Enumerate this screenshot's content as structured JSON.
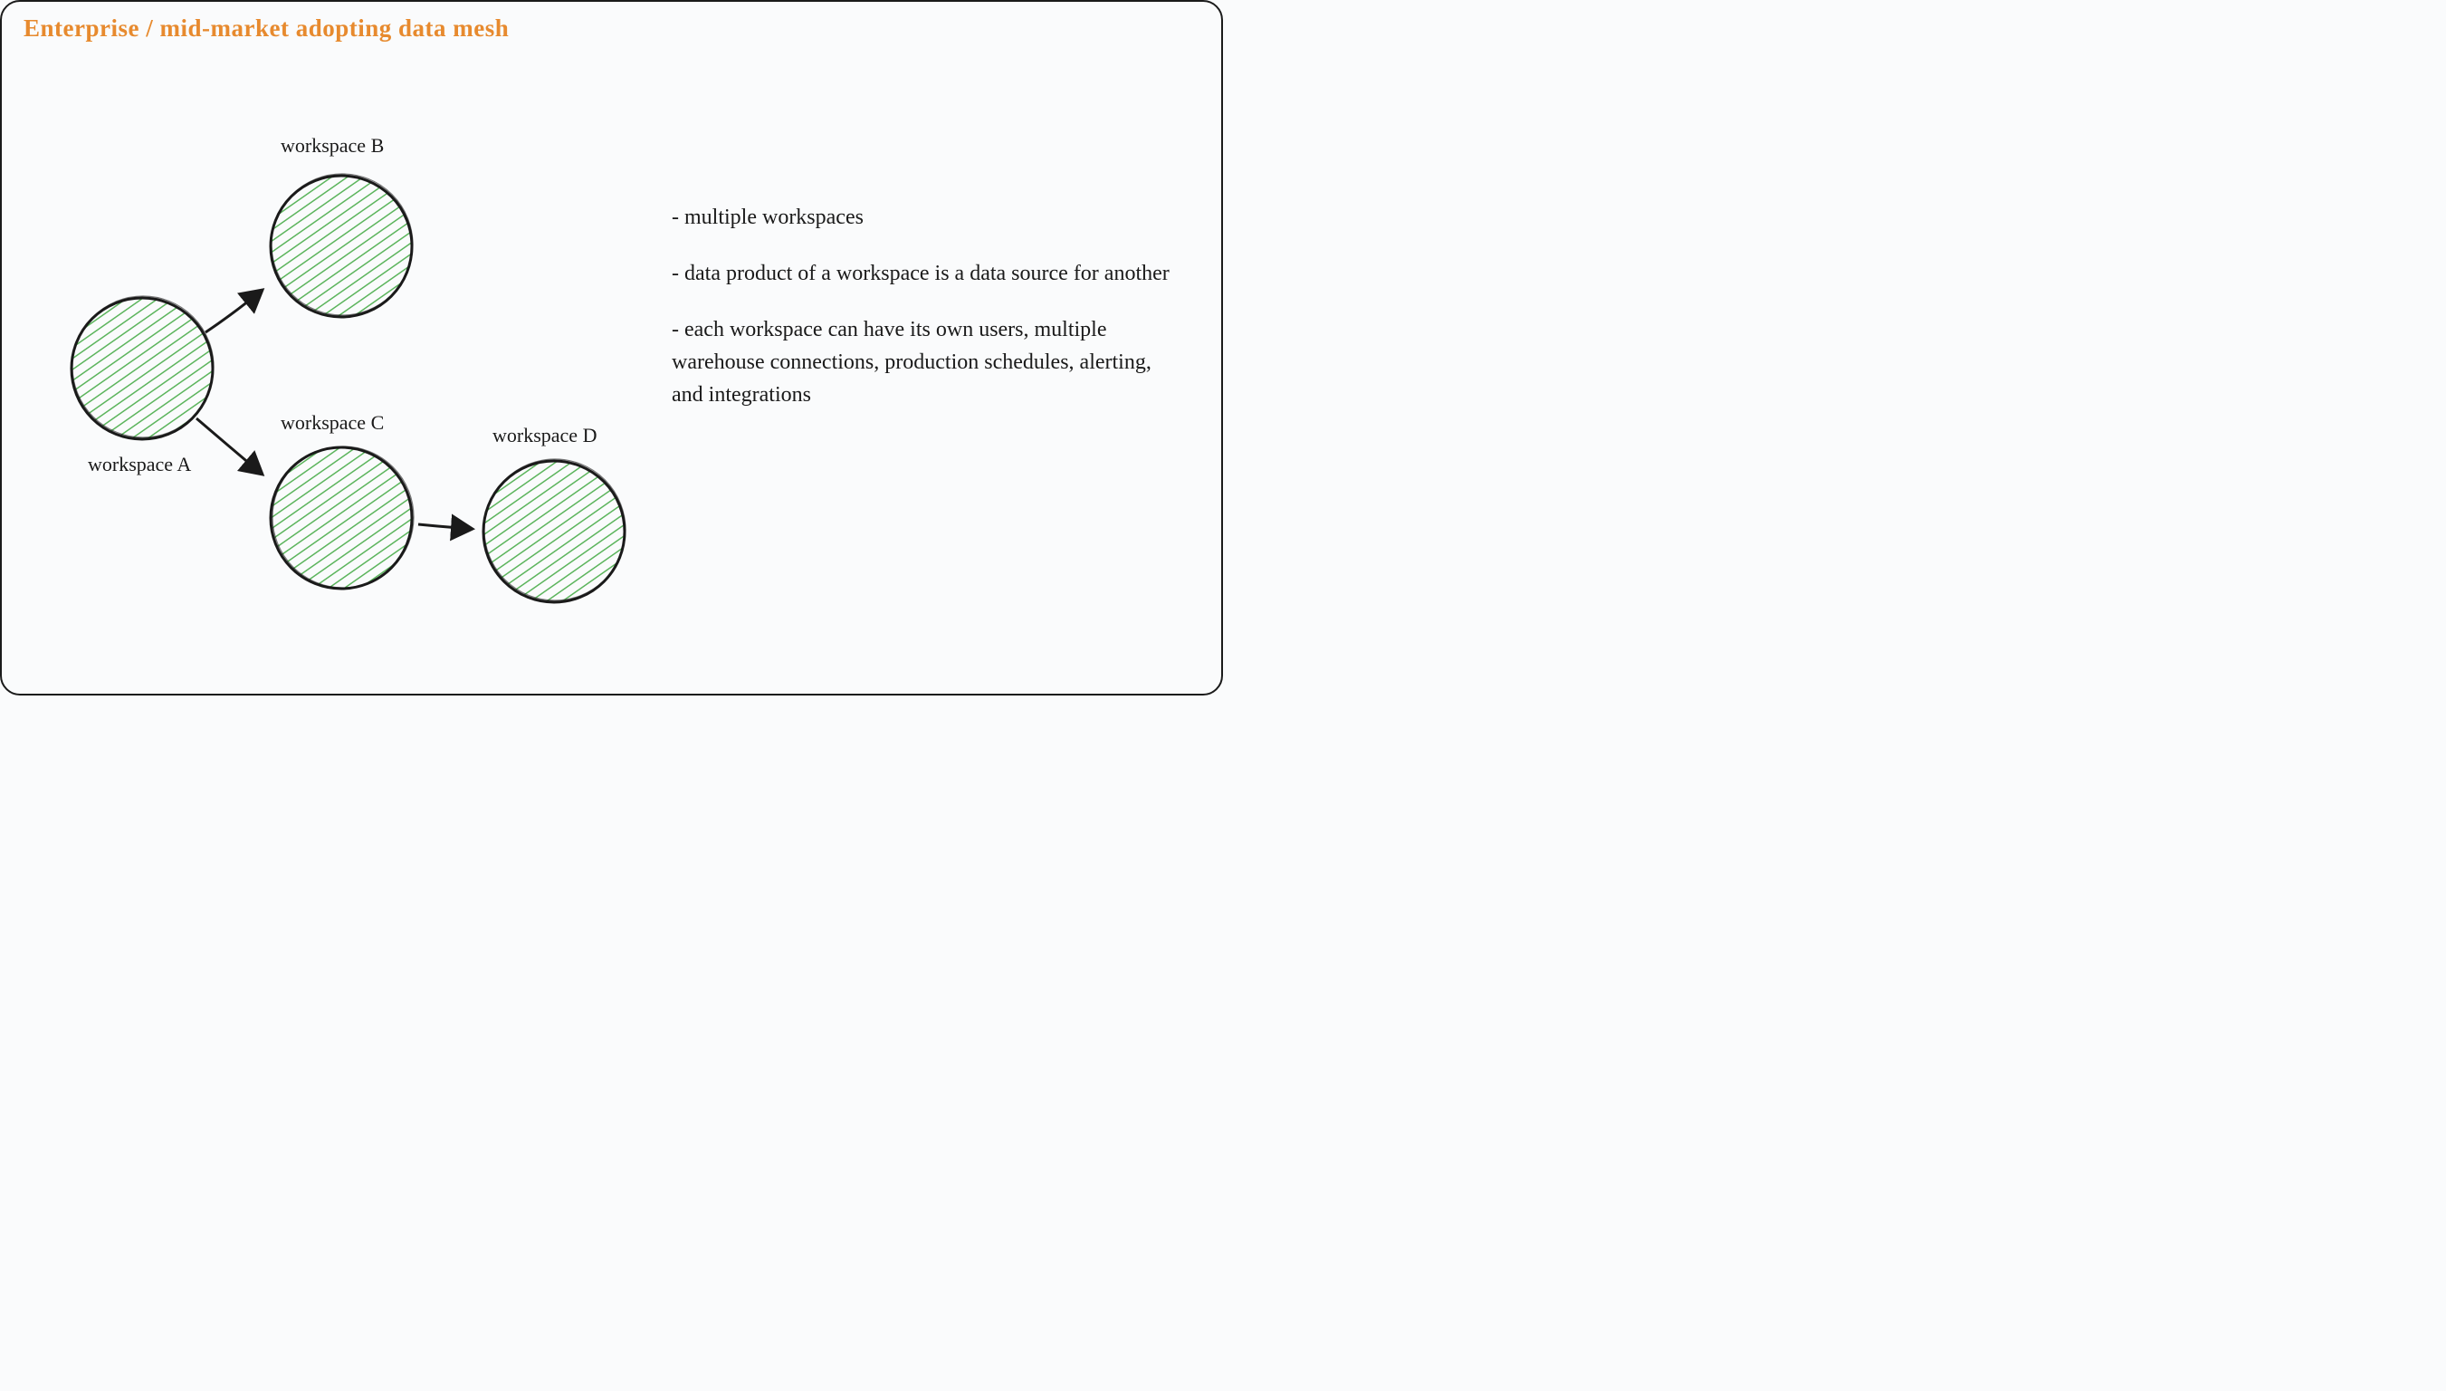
{
  "title": "Enterprise / mid-market adopting data mesh",
  "nodes": {
    "a": {
      "label": "workspace A"
    },
    "b": {
      "label": "workspace B"
    },
    "c": {
      "label": "workspace C"
    },
    "d": {
      "label": "workspace D"
    }
  },
  "bullets": {
    "b1": "- multiple workspaces",
    "b2": "- data product of a workspace is a data source for another",
    "b3": "- each workspace can have its own users, multiple warehouse connections, production schedules, alerting, and integrations"
  },
  "colors": {
    "title": "#e78a2e",
    "ink": "#1a1a1a",
    "circleFill": "#3fa83f",
    "circleStroke": "#1a1a1a"
  }
}
